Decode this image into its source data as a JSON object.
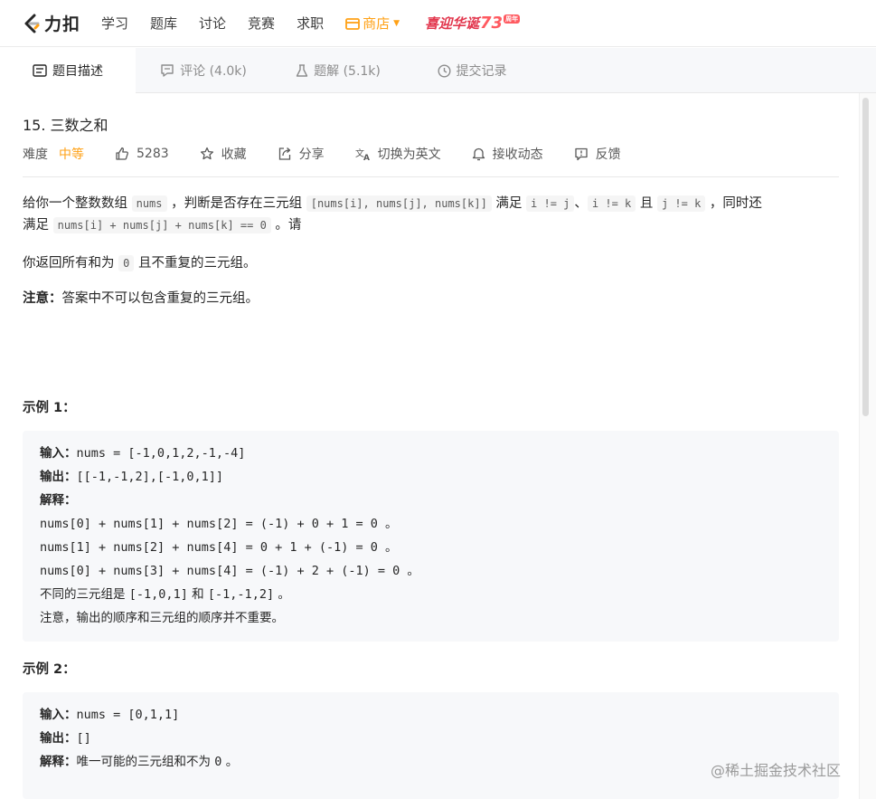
{
  "nav": {
    "logo_text": "力扣",
    "items": [
      "学习",
      "题库",
      "讨论",
      "竞赛",
      "求职"
    ],
    "shop_label": "商店",
    "banner_text": "喜迎华诞",
    "banner_num": "73",
    "banner_tag": "周年"
  },
  "tabs": [
    {
      "label": "题目描述",
      "icon": "description-icon"
    },
    {
      "label": "评论 (4.0k)",
      "icon": "comment-icon"
    },
    {
      "label": "题解 (5.1k)",
      "icon": "flask-icon"
    },
    {
      "label": "提交记录",
      "icon": "clock-icon"
    }
  ],
  "problem": {
    "title": "15. 三数之和",
    "difficulty_label": "难度",
    "difficulty_value": "中等",
    "likes": "5283",
    "collect": "收藏",
    "share": "分享",
    "switch_lang": "切换为英文",
    "subscribe": "接收动态",
    "feedback": "反馈"
  },
  "description": {
    "p1_a": "给你一个整数数组 ",
    "p1_code1": "nums",
    "p1_b": " ，判断是否存在三元组 ",
    "p1_code2": "[nums[i], nums[j], nums[k]]",
    "p1_c": " 满足 ",
    "p1_code3": "i != j",
    "p1_d": "、",
    "p1_code4": "i != k",
    "p1_e": " 且 ",
    "p1_code5": "j != k",
    "p1_f": " ，同时还",
    "p2_a": "满足 ",
    "p2_code1": "nums[i] + nums[j] + nums[k] == 0",
    "p2_b": " 。请",
    "p3_a": "你返回所有和为 ",
    "p3_code1": "0",
    "p3_b": " 且不重复的三元组。",
    "note_label": "注意：",
    "note_text": "答案中不可以包含重复的三元组。"
  },
  "example1": {
    "title": "示例 1：",
    "input_label": "输入：",
    "input_value": "nums = [-1,0,1,2,-1,-4]",
    "output_label": "输出：",
    "output_value": "[[-1,-1,2],[-1,0,1]]",
    "explain_label": "解释：",
    "line1": "nums[0] + nums[1] + nums[2] = (-1) + 0 + 1 = 0 。",
    "line2": "nums[1] + nums[2] + nums[4] = 0 + 1 + (-1) = 0 。",
    "line3": "nums[0] + nums[3] + nums[4] = (-1) + 2 + (-1) = 0 。",
    "line4_a": "不同的三元组是 ",
    "line4_b": "[-1,0,1]",
    "line4_c": " 和 ",
    "line4_d": "[-1,-1,2]",
    "line4_e": " 。",
    "line5": "注意，输出的顺序和三元组的顺序并不重要。"
  },
  "example2": {
    "title": "示例 2：",
    "input_label": "输入：",
    "input_value": "nums = [0,1,1]",
    "output_label": "输出：",
    "output_value": "[]",
    "explain_label": "解释：",
    "explain_a": "唯一可能的三元组和不为 ",
    "explain_b": "0",
    "explain_c": " 。"
  },
  "watermark": "@稀土掘金技术社区",
  "colors": {
    "accent": "#ffa116",
    "text": "#262626",
    "muted": "#8c8c8c"
  }
}
